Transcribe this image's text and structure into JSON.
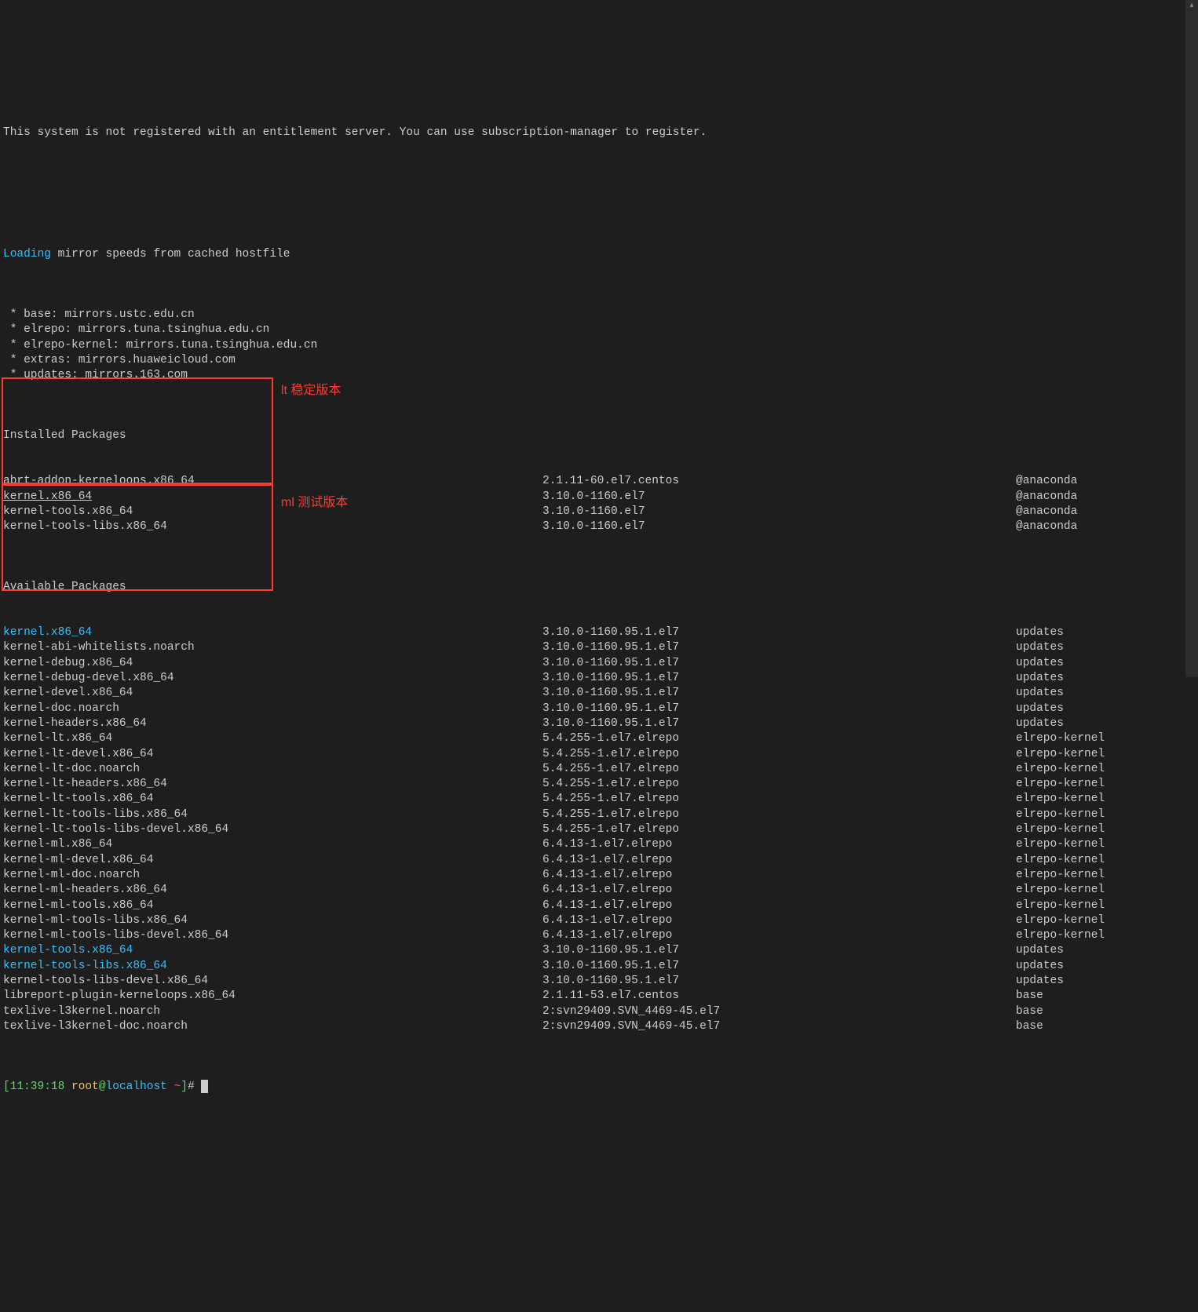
{
  "header": [
    "This system is not registered with an entitlement server. You can use subscription-manager to register.",
    ""
  ],
  "loading_prefix": "Loading",
  "loading_suffix": " mirror speeds from cached hostfile",
  "mirrors": [
    " * base: mirrors.ustc.edu.cn",
    " * elrepo: mirrors.tuna.tsinghua.edu.cn",
    " * elrepo-kernel: mirrors.tuna.tsinghua.edu.cn",
    " * extras: mirrors.huaweicloud.com",
    " * updates: mirrors.163.com"
  ],
  "installed_heading": "Installed Packages",
  "installed": [
    {
      "name": "abrt-addon-kerneloops.x86_64",
      "ver": "2.1.11-60.el7.centos",
      "repo": "@anaconda",
      "hl": false,
      "ul": false
    },
    {
      "name": "kernel.x86_64",
      "ver": "3.10.0-1160.el7",
      "repo": "@anaconda",
      "hl": false,
      "ul": true
    },
    {
      "name": "kernel-tools.x86_64",
      "ver": "3.10.0-1160.el7",
      "repo": "@anaconda",
      "hl": false,
      "ul": false
    },
    {
      "name": "kernel-tools-libs.x86_64",
      "ver": "3.10.0-1160.el7",
      "repo": "@anaconda",
      "hl": false,
      "ul": false
    }
  ],
  "available_heading": "Available Packages",
  "available": [
    {
      "name": "kernel.x86_64",
      "ver": "3.10.0-1160.95.1.el7",
      "repo": "updates",
      "hl": true,
      "ul": false
    },
    {
      "name": "kernel-abi-whitelists.noarch",
      "ver": "3.10.0-1160.95.1.el7",
      "repo": "updates",
      "hl": false,
      "ul": false
    },
    {
      "name": "kernel-debug.x86_64",
      "ver": "3.10.0-1160.95.1.el7",
      "repo": "updates",
      "hl": false,
      "ul": false
    },
    {
      "name": "kernel-debug-devel.x86_64",
      "ver": "3.10.0-1160.95.1.el7",
      "repo": "updates",
      "hl": false,
      "ul": false
    },
    {
      "name": "kernel-devel.x86_64",
      "ver": "3.10.0-1160.95.1.el7",
      "repo": "updates",
      "hl": false,
      "ul": false
    },
    {
      "name": "kernel-doc.noarch",
      "ver": "3.10.0-1160.95.1.el7",
      "repo": "updates",
      "hl": false,
      "ul": false
    },
    {
      "name": "kernel-headers.x86_64",
      "ver": "3.10.0-1160.95.1.el7",
      "repo": "updates",
      "hl": false,
      "ul": false
    },
    {
      "name": "kernel-lt.x86_64",
      "ver": "5.4.255-1.el7.elrepo",
      "repo": "elrepo-kernel",
      "hl": false,
      "ul": false
    },
    {
      "name": "kernel-lt-devel.x86_64",
      "ver": "5.4.255-1.el7.elrepo",
      "repo": "elrepo-kernel",
      "hl": false,
      "ul": false
    },
    {
      "name": "kernel-lt-doc.noarch",
      "ver": "5.4.255-1.el7.elrepo",
      "repo": "elrepo-kernel",
      "hl": false,
      "ul": false
    },
    {
      "name": "kernel-lt-headers.x86_64",
      "ver": "5.4.255-1.el7.elrepo",
      "repo": "elrepo-kernel",
      "hl": false,
      "ul": false
    },
    {
      "name": "kernel-lt-tools.x86_64",
      "ver": "5.4.255-1.el7.elrepo",
      "repo": "elrepo-kernel",
      "hl": false,
      "ul": false
    },
    {
      "name": "kernel-lt-tools-libs.x86_64",
      "ver": "5.4.255-1.el7.elrepo",
      "repo": "elrepo-kernel",
      "hl": false,
      "ul": false
    },
    {
      "name": "kernel-lt-tools-libs-devel.x86_64",
      "ver": "5.4.255-1.el7.elrepo",
      "repo": "elrepo-kernel",
      "hl": false,
      "ul": false
    },
    {
      "name": "kernel-ml.x86_64",
      "ver": "6.4.13-1.el7.elrepo",
      "repo": "elrepo-kernel",
      "hl": false,
      "ul": false
    },
    {
      "name": "kernel-ml-devel.x86_64",
      "ver": "6.4.13-1.el7.elrepo",
      "repo": "elrepo-kernel",
      "hl": false,
      "ul": false
    },
    {
      "name": "kernel-ml-doc.noarch",
      "ver": "6.4.13-1.el7.elrepo",
      "repo": "elrepo-kernel",
      "hl": false,
      "ul": false
    },
    {
      "name": "kernel-ml-headers.x86_64",
      "ver": "6.4.13-1.el7.elrepo",
      "repo": "elrepo-kernel",
      "hl": false,
      "ul": false
    },
    {
      "name": "kernel-ml-tools.x86_64",
      "ver": "6.4.13-1.el7.elrepo",
      "repo": "elrepo-kernel",
      "hl": false,
      "ul": false
    },
    {
      "name": "kernel-ml-tools-libs.x86_64",
      "ver": "6.4.13-1.el7.elrepo",
      "repo": "elrepo-kernel",
      "hl": false,
      "ul": false
    },
    {
      "name": "kernel-ml-tools-libs-devel.x86_64",
      "ver": "6.4.13-1.el7.elrepo",
      "repo": "elrepo-kernel",
      "hl": false,
      "ul": false
    },
    {
      "name": "kernel-tools.x86_64",
      "ver": "3.10.0-1160.95.1.el7",
      "repo": "updates",
      "hl": true,
      "ul": false
    },
    {
      "name": "kernel-tools-libs.x86_64",
      "ver": "3.10.0-1160.95.1.el7",
      "repo": "updates",
      "hl": true,
      "ul": false
    },
    {
      "name": "kernel-tools-libs-devel.x86_64",
      "ver": "3.10.0-1160.95.1.el7",
      "repo": "updates",
      "hl": false,
      "ul": false
    },
    {
      "name": "libreport-plugin-kerneloops.x86_64",
      "ver": "2.1.11-53.el7.centos",
      "repo": "base",
      "hl": false,
      "ul": false
    },
    {
      "name": "texlive-l3kernel.noarch",
      "ver": "2:svn29409.SVN_4469-45.el7",
      "repo": "base",
      "hl": false,
      "ul": false
    },
    {
      "name": "texlive-l3kernel-doc.noarch",
      "ver": "2:svn29409.SVN_4469-45.el7",
      "repo": "base",
      "hl": false,
      "ul": false
    }
  ],
  "prompt": {
    "lb": "[",
    "time": "11:39:18 ",
    "user": "root",
    "at": "@",
    "host": "localhost ",
    "path": "~",
    "rb": "]",
    "hash": "# "
  },
  "annotation_lt": "lt 稳定版本",
  "annotation_ml": "ml 测试版本"
}
